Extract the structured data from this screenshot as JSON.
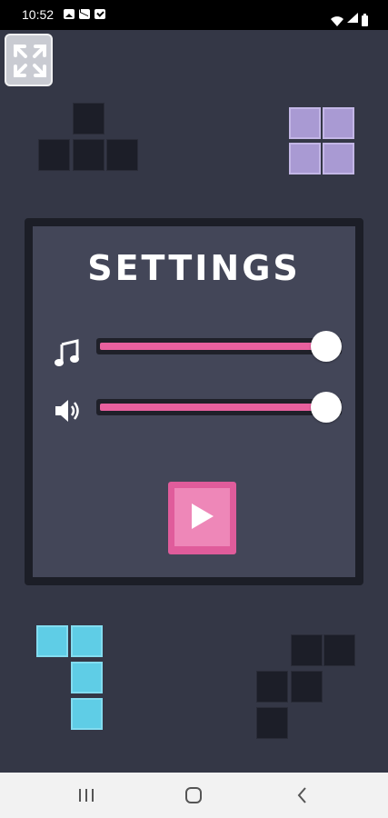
{
  "status_bar": {
    "time": "10:52",
    "left_icons": [
      "image-icon",
      "mail-icon",
      "check-icon"
    ],
    "right_icons": [
      "wifi-icon",
      "signal-icon",
      "battery-icon"
    ]
  },
  "game": {
    "background_color": "#343746",
    "fullscreen_icon": "expand-icon",
    "decor_colors": {
      "dark": "#1c1e28",
      "purple": "#a99ad3",
      "cyan": "#5fcde6"
    }
  },
  "settings": {
    "title": "SETTINGS",
    "music": {
      "icon": "music-note-icon",
      "level": 1.0
    },
    "sound": {
      "icon": "speaker-icon",
      "level": 1.0
    },
    "slider_color": "#e8609e",
    "play_icon": "play-icon",
    "play_color": "#e05c9b"
  },
  "nav_bar": {
    "buttons": [
      "recent-apps-icon",
      "home-icon",
      "back-icon"
    ]
  }
}
